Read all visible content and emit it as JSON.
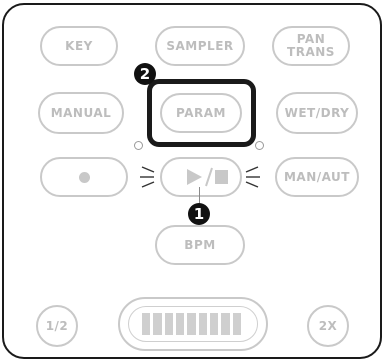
{
  "buttons": {
    "key": "KEY",
    "sampler": "SAMPLER",
    "pan_trans": "PAN\nTRANS",
    "manual": "MANUAL",
    "param": "PARAM",
    "wet_dry": "WET/DRY",
    "man_aut": "MAN/AUT",
    "bpm": "BPM",
    "half": "1/2",
    "double": "2X"
  },
  "badges": {
    "step_1": "1",
    "step_2": "2"
  },
  "icons": {
    "record": "record-dot-icon",
    "play_stop": "play-stop-icon",
    "flash": "flash-indicator-icon",
    "meter": "level-meter-icon"
  },
  "meter": {
    "segments": 9
  },
  "colors": {
    "outline": "#c9c9c9",
    "label": "#bdbdbd",
    "highlight": "#1a1a1a"
  }
}
